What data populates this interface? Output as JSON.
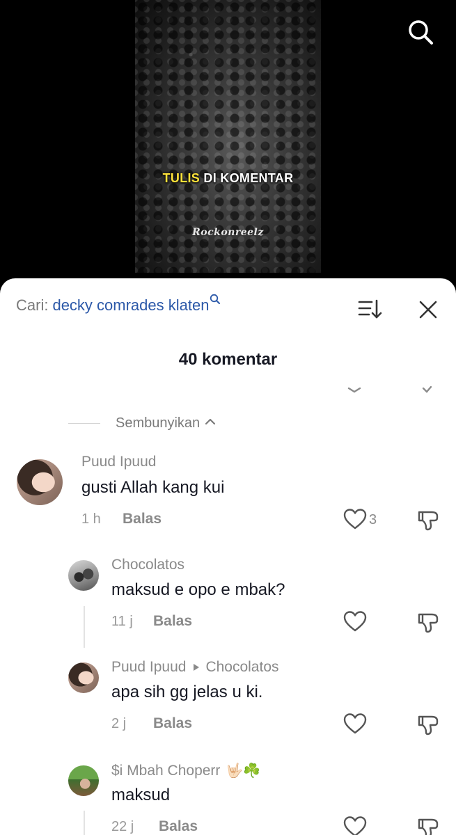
{
  "video": {
    "caption_highlight": "TULIS",
    "caption_rest": " DI KOMENTAR",
    "watermark": "Rockonreelz"
  },
  "search": {
    "prefix": "Cari:",
    "query": "decky comrades klaten"
  },
  "comment_count": "40 komentar",
  "hide_label": "Sembunyikan",
  "comments": [
    {
      "user": "Puud Ipuud",
      "text": "gusti Allah kang kui",
      "time": "1 h",
      "reply": "Balas",
      "likes": "3",
      "avatar": "avatar-puud-ipuud"
    },
    {
      "user": "Chocolatos",
      "text": "maksud e opo e mbak?",
      "time": "11 j",
      "reply": "Balas",
      "avatar": "avatar-chocolatos"
    },
    {
      "user": "Puud Ipuud",
      "reply_to": "Chocolatos",
      "text": "apa sih gg jelas u ki.",
      "time": "2 j",
      "reply": "Balas",
      "avatar": "avatar-puud-ipuud"
    },
    {
      "user": "$i Mbah Choperr",
      "emoji": "🤟🏻☘️",
      "text": "maksud",
      "time": "22 j",
      "reply": "Balas",
      "avatar": "avatar-mbah-choperr"
    }
  ],
  "icons": {
    "search": "search-icon",
    "sort": "sort-icon",
    "close": "close-icon",
    "like": "heart-icon",
    "dislike": "thumbs-down-icon",
    "collapse": "chevron-up-icon",
    "reply_to": "triangle-right-icon"
  },
  "colors": {
    "caption_highlight": "#ffe23a",
    "search_query": "#2b58a8",
    "text_primary": "#161823",
    "text_secondary": "#8a8a8a"
  }
}
